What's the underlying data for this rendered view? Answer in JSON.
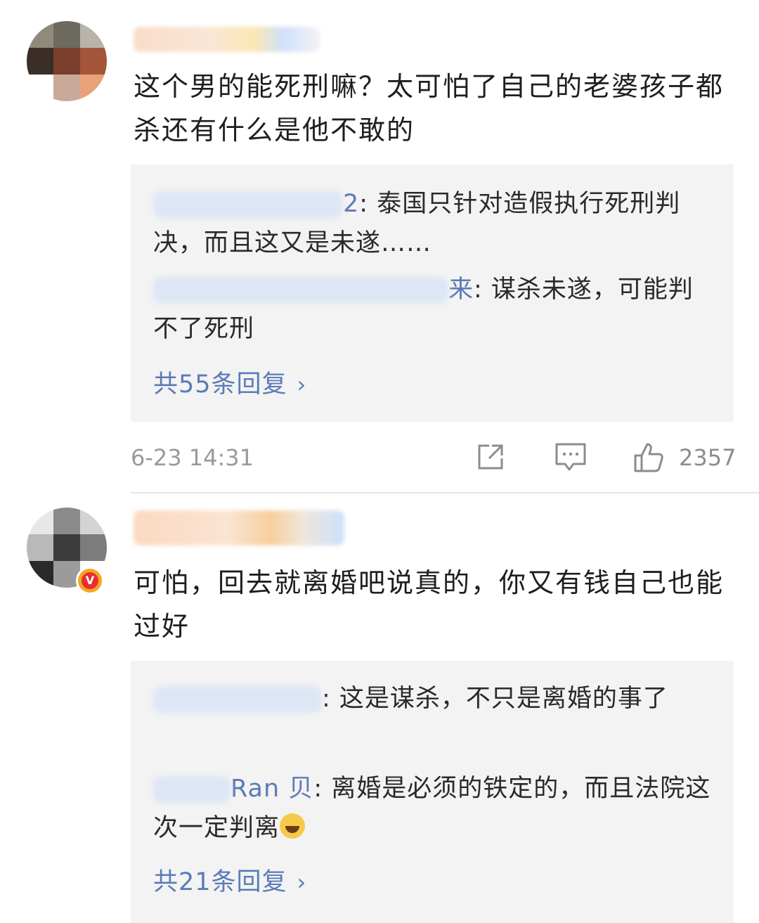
{
  "comments": [
    {
      "text": "这个男的能死刑嘛？太可怕了自己的老婆孩子都杀还有什么是他不敢的",
      "replies": [
        {
          "name_visible": "2",
          "text": ": 泰国只针对造假执行死刑判决，而且这又是未遂……"
        },
        {
          "name_visible": "来",
          "text": ": 谋杀未遂，可能判不了死刑"
        }
      ],
      "more_replies": "共55条回复",
      "timestamp": "6-23 14:31",
      "like_count": "2357"
    },
    {
      "text": "可怕，回去就离婚吧说真的，你又有钱自己也能过好",
      "replies": [
        {
          "name_visible": "",
          "text": ": 这是谋杀，不只是离婚的事了"
        },
        {
          "name_visible": "Ran 贝",
          "text": ": 离婚是必须的铁定的，而且法院这次一定判离"
        }
      ],
      "more_replies": "共21条回复"
    }
  ],
  "icons": {
    "share": "share-icon",
    "comment": "comment-icon",
    "like": "like-icon",
    "verified": "verified-badge-icon",
    "chevron": "chevron-right-icon",
    "emoji": "laughing-crying-emoji"
  },
  "colors": {
    "link": "#5b7bb7",
    "reply_bg": "#f3f3f3",
    "meta": "#9a9a9a"
  }
}
